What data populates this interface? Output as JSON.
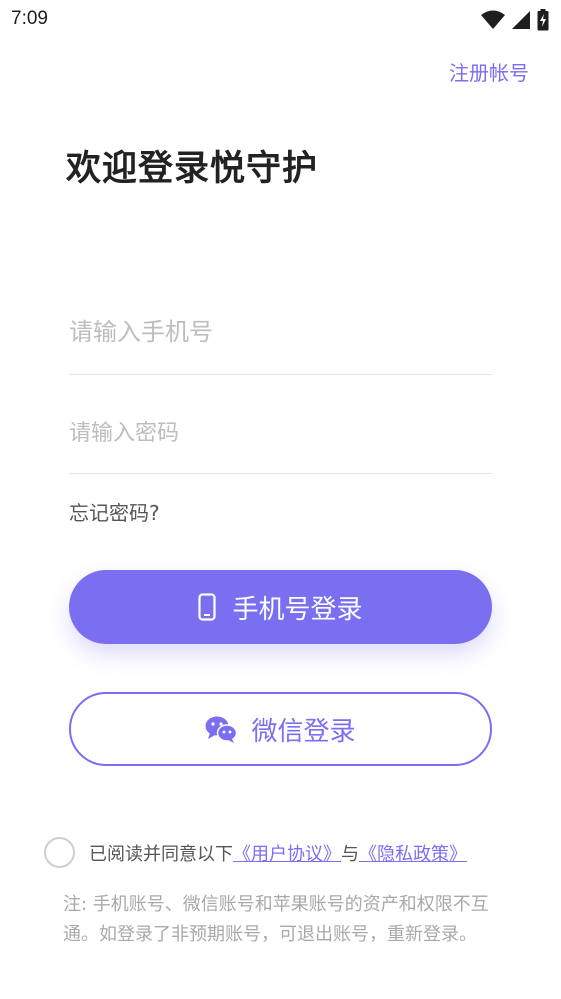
{
  "status_bar": {
    "time": "7:09",
    "icons": [
      "wifi-icon",
      "signal-icon",
      "battery-charging-icon"
    ]
  },
  "header": {
    "register_label": "注册帐号"
  },
  "title": "欢迎登录悦守护",
  "form": {
    "phone_placeholder": "请输入手机号",
    "password_placeholder": "请输入密码",
    "forgot_label": "忘记密码?"
  },
  "buttons": {
    "phone_login_label": "手机号登录",
    "wechat_login_label": "微信登录"
  },
  "agreement": {
    "prefix": "已阅读并同意以下",
    "user_agreement": "《用户协议》",
    "and": "与",
    "privacy_policy": "《隐私政策》"
  },
  "note": "注: 手机账号、微信账号和苹果账号的资产和权限不互通。如登录了非预期账号，可退出账号，重新登录。",
  "colors": {
    "accent": "#7a6ff0",
    "text": "#222222",
    "muted": "#a9a9a9"
  }
}
